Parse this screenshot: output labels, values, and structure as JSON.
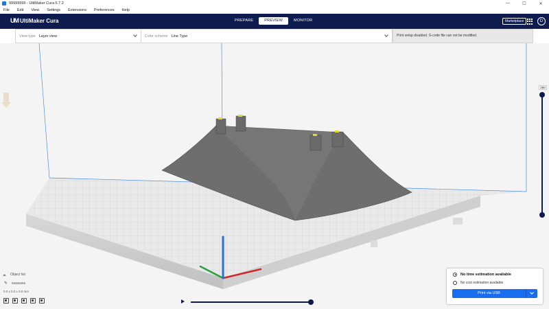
{
  "window": {
    "title": "99999999 - UltiMaker Cura 5.7.2",
    "minimize": "—",
    "maximize": "☐",
    "close": "✕"
  },
  "menu": {
    "items": [
      "File",
      "Edit",
      "View",
      "Settings",
      "Extensions",
      "Preferences",
      "Help"
    ]
  },
  "header": {
    "logo_mark": "UM",
    "logo_text": "UltiMaker Cura",
    "stages": [
      "PREPARE",
      "PREVIEW",
      "MONITOR"
    ],
    "active_stage": "PREVIEW",
    "marketplace_label": "Marketplace",
    "avatar_initial": "D",
    "apps_icon": "apps-grid-icon"
  },
  "view_options": {
    "view_type_label": "View type",
    "view_type_value": "Layer view",
    "color_scheme_label": "Color scheme",
    "color_scheme_value": "Line Type",
    "notice": "Print setup disabled. G-code file can not be modified."
  },
  "layer_slider": {
    "current_layer": "250",
    "fraction": 1.0
  },
  "playback": {
    "progress": 1.0
  },
  "object_list": {
    "header": "Object list",
    "object_name": "99999999",
    "dimensions": "0.0 x 0.0 x 0.0 mm"
  },
  "print_panel": {
    "time_estimate": "No time estimation available",
    "cost_estimate": "No cost estimation available",
    "print_button": "Print via USB"
  },
  "colors": {
    "header_bg": "#0d1b4f",
    "accent": "#196ef0",
    "axis_x": "#cc2a2a",
    "axis_y": "#2e9e3e",
    "axis_z": "#2a6fe0",
    "model": "#6e6e6e"
  }
}
